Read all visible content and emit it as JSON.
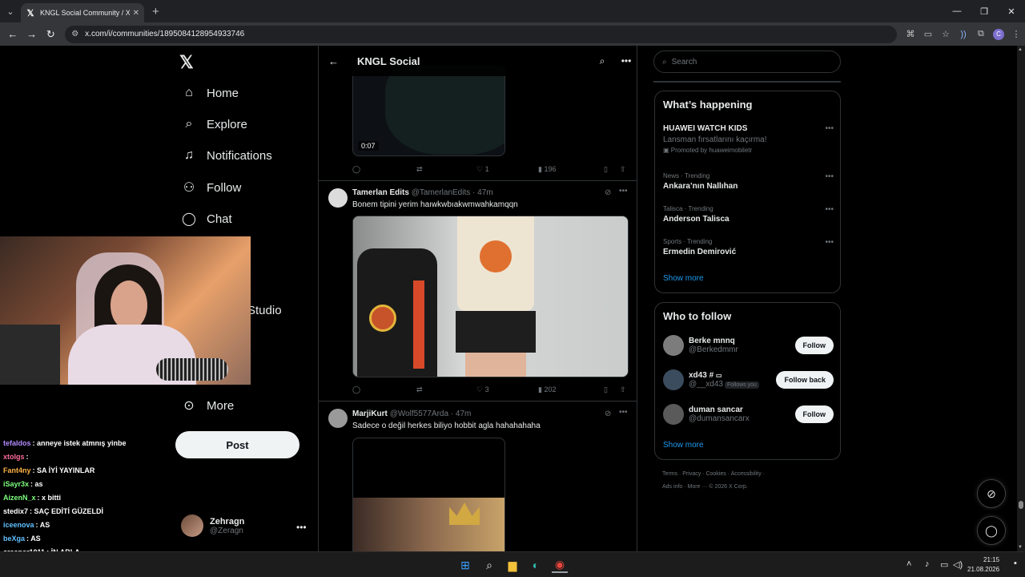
{
  "browser": {
    "tab_title": "KNGL Social Community / X",
    "url": "x.com/i/communities/1895084128954933746"
  },
  "nav": {
    "items": [
      {
        "label": "Home",
        "icon": "home-icon",
        "glyph": "⌂"
      },
      {
        "label": "Explore",
        "icon": "search-icon",
        "glyph": "⌕"
      },
      {
        "label": "Notifications",
        "icon": "bell-icon",
        "glyph": "🔔︎"
      },
      {
        "label": "Follow",
        "icon": "follow-icon",
        "glyph": "👤︎"
      },
      {
        "label": "Chat",
        "icon": "chat-icon",
        "glyph": "💬︎"
      }
    ],
    "studio_label": "Studio",
    "more_label": "More",
    "post_label": "Post",
    "account": {
      "name": "Zehragn",
      "handle": "@Zeragn"
    }
  },
  "stream_chat": [
    {
      "user": "tefaldos",
      "msg": "anneye istek atmnış yinbe",
      "color": "#b48cff"
    },
    {
      "user": "xtolgs",
      "msg": "",
      "color": "#ff6b9a"
    },
    {
      "user": "Fant4ny",
      "msg": "SA İYİ YAYINLAR",
      "color": "#ffb347"
    },
    {
      "user": "iSayr3x",
      "msg": "as",
      "color": "#7fff7f"
    },
    {
      "user": "AizenN_x",
      "msg": "x bitti",
      "color": "#7fff7f"
    },
    {
      "user": "stedix7",
      "msg": "SAÇ EDİTİ GÜZELDİ",
      "color": "#ffffff"
    },
    {
      "user": "iceenova",
      "msg": "AS",
      "color": "#60c0ff"
    },
    {
      "user": "beXga",
      "msg": "AS",
      "color": "#60c0ff"
    },
    {
      "user": "creeper1011",
      "msg": "İN ABLA",
      "color": "#ffffff"
    }
  ],
  "column": {
    "title": "KNGL Social",
    "first_video_time": "0:07",
    "tweets": [
      {
        "likes": "1",
        "views": "196"
      },
      {
        "name": "Tamerlan Edits",
        "handle": "@TamerlanEdits",
        "time": "· 47m",
        "text": "Bonem tipini yerim haıwkwbıakwmwahkamqqn",
        "likes": "3",
        "views": "202"
      },
      {
        "name": "MarjiKurt",
        "handle": "@Wolf5577Arda",
        "time": "· 47m",
        "text": "Sadece o değil herkes biliyo hobbit agla hahahahaha"
      }
    ]
  },
  "search": {
    "placeholder": "Search"
  },
  "whats_happening": {
    "title": "What’s happening",
    "promo": {
      "topic": "HUAWEI WATCH KIDS",
      "sub": "Lansman fırsatlarını kaçırma!",
      "promoted": "Promoted by huaweimobiletr"
    },
    "trends": [
      {
        "meta": "News · Trending",
        "topic": "Ankara’nın Nallıhan"
      },
      {
        "meta": "Talisca · Trending",
        "topic": "Anderson Talisca"
      },
      {
        "meta": "Sports · Trending",
        "topic": "Ermedin Demirović"
      }
    ],
    "show_more": "Show more"
  },
  "who_to_follow": {
    "title": "Who to follow",
    "users": [
      {
        "name": "Berke mnnq",
        "handle": "@Berkedmmr",
        "button": "Follow"
      },
      {
        "name": "xd43 #",
        "handle": "@__xd43",
        "follows_you": "Follows you",
        "button": "Follow back"
      },
      {
        "name": "duman sancar",
        "handle": "@dumansancarx",
        "button": "Follow"
      }
    ],
    "show_more": "Show more"
  },
  "footer": {
    "line1": "Terms · Privacy · Cookies · Accessibility ·",
    "line2": "Ads info · More ··· © 2026 X Corp."
  },
  "taskbar": {
    "time": "21:15",
    "date": "21.08.2026"
  }
}
